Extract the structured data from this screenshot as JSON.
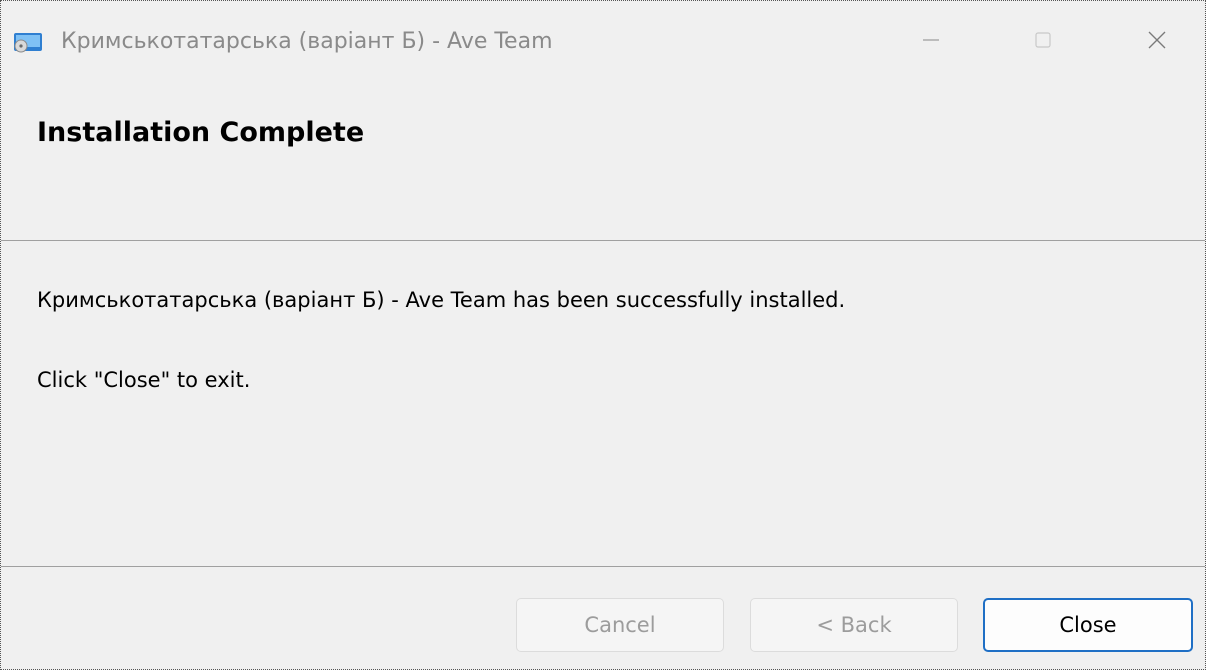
{
  "window": {
    "title": "Кримськотатарська (варіант Б) - Ave Team",
    "app_icon": "installer-disc-icon",
    "controls": {
      "minimize_icon": "minimize-icon",
      "maximize_icon": "maximize-icon",
      "close_icon": "close-icon"
    }
  },
  "page": {
    "heading": "Installation Complete",
    "message": "Кримськотатарська (варіант Б) - Ave Team has been successfully installed.",
    "instruction": "Click \"Close\" to exit."
  },
  "buttons": {
    "cancel": {
      "label": "Cancel",
      "enabled": false
    },
    "back": {
      "label": "< Back",
      "enabled": false
    },
    "close": {
      "label": "Close",
      "enabled": true
    }
  },
  "colors": {
    "window_background": "#f0f0f0",
    "accent": "#1f6fc5",
    "disabled_text": "#9c9c9c",
    "title_text": "#8a8a8a"
  }
}
